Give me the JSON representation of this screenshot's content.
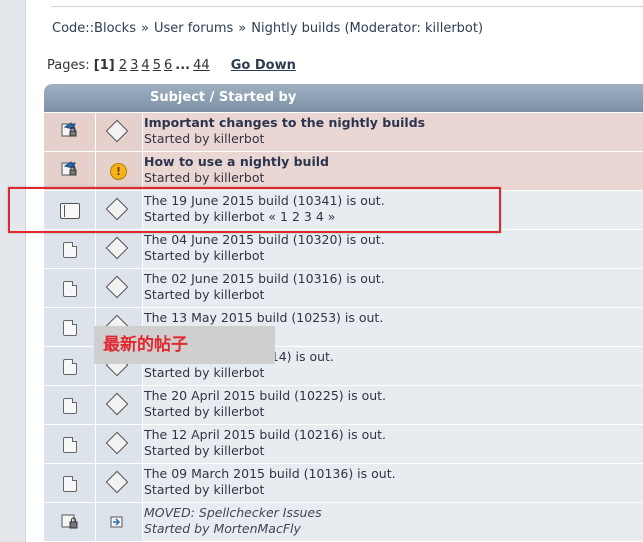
{
  "breadcrumb": [
    "Code::Blocks",
    "User forums",
    "Nightly builds (Moderator: killerbot)"
  ],
  "breadcrumb_sep": "»",
  "pagination": {
    "label": "Pages:",
    "current": "[1]",
    "pages": [
      "2",
      "3",
      "4",
      "5",
      "6"
    ],
    "ellipsis": "...",
    "last": "44",
    "go_down": "Go Down"
  },
  "table": {
    "header_subject": "Subject / Started by",
    "rows": [
      {
        "kind": "sticky",
        "topic_icon": "sticky-locked-topic-icon",
        "msg_icon": "diamond-message-icon",
        "title": "Important changes to the nightly builds",
        "started_by": "Started by killerbot"
      },
      {
        "kind": "sticky",
        "topic_icon": "sticky-locked-topic-icon",
        "msg_icon": "exclamation-icon",
        "title": "How to use a nightly build",
        "started_by": "Started by killerbot"
      },
      {
        "kind": "normal",
        "topic_icon": "hot-topic-icon",
        "msg_icon": "diamond-message-icon",
        "title": "The 19 June 2015 build (10341) is out.",
        "started_by": "Started by killerbot",
        "page_links": "« 1 2 3 4 »"
      },
      {
        "kind": "normal",
        "topic_icon": "topic-icon",
        "msg_icon": "diamond-message-icon",
        "title": "The 04 June 2015 build (10320) is out.",
        "started_by": "Started by killerbot"
      },
      {
        "kind": "normal",
        "topic_icon": "topic-icon",
        "msg_icon": "diamond-message-icon",
        "title": "The 02 June 2015 build (10316) is out.",
        "started_by": "Started by killerbot"
      },
      {
        "kind": "normal",
        "topic_icon": "topic-icon",
        "msg_icon": "diamond-message-icon",
        "title": "The 13 May 2015 build (10253) is out.",
        "started_by": ""
      },
      {
        "kind": "normal",
        "topic_icon": "topic-icon",
        "msg_icon": "diamond-message-icon",
        "title": "(10314) is out.",
        "started_by": "Started by killerbot"
      },
      {
        "kind": "normal",
        "topic_icon": "topic-icon",
        "msg_icon": "diamond-message-icon",
        "title": "The 20 April 2015 build (10225) is out.",
        "started_by": "Started by killerbot"
      },
      {
        "kind": "normal",
        "topic_icon": "topic-icon",
        "msg_icon": "diamond-message-icon",
        "title": "The 12 April 2015 build (10216) is out.",
        "started_by": "Started by killerbot"
      },
      {
        "kind": "normal",
        "topic_icon": "topic-icon",
        "msg_icon": "diamond-message-icon",
        "title": "The 09 March 2015 build (10136) is out.",
        "started_by": "Started by killerbot"
      },
      {
        "kind": "normal",
        "topic_icon": "moved-locked-topic-icon",
        "msg_icon": "moved-arrow-icon",
        "title": "MOVED: Spellchecker Issues",
        "started_by": "Started by MortenMacFly"
      }
    ]
  },
  "annotation": {
    "text": "最新的帖子",
    "color": "#e0292f"
  },
  "colors": {
    "highlight_box": "#e0292f",
    "sticky_row": "#ead7d3",
    "normal_row": "#e7ecf1",
    "header": "#8da0b5"
  }
}
